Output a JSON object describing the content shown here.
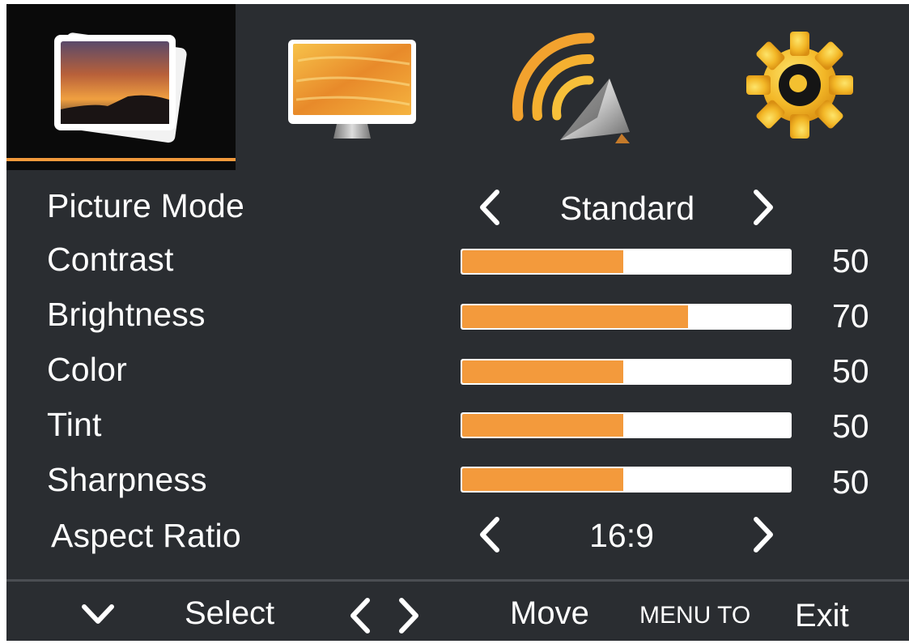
{
  "colors": {
    "accent": "#f39a3c",
    "background": "#2a2d31",
    "selected_tab_bg": "#0a0a0a"
  },
  "tabs": [
    {
      "name": "picture",
      "icon": "photo-icon",
      "selected": true
    },
    {
      "name": "display",
      "icon": "monitor-icon",
      "selected": false
    },
    {
      "name": "signal",
      "icon": "satellite-dish-icon",
      "selected": false
    },
    {
      "name": "settings",
      "icon": "gear-icon",
      "selected": false
    }
  ],
  "menu": {
    "picture_mode": {
      "label": "Picture  Mode",
      "value": "Standard"
    },
    "contrast": {
      "label": "Contrast",
      "value": "50",
      "level": 50
    },
    "brightness": {
      "label": "Brightness",
      "value": "70",
      "level": 70
    },
    "color": {
      "label": "Color",
      "value": "50",
      "level": 50
    },
    "tint": {
      "label": "Tint",
      "value": "50",
      "level": 50
    },
    "sharpness": {
      "label": "Sharpness",
      "value": "50",
      "level": 50
    },
    "aspect_ratio": {
      "label": "Aspect  Ratio",
      "value": "16:9"
    }
  },
  "footer": {
    "select_label": "Select",
    "move_label": "Move",
    "menu_to_label": "MENU TO",
    "exit_label": "Exit"
  }
}
